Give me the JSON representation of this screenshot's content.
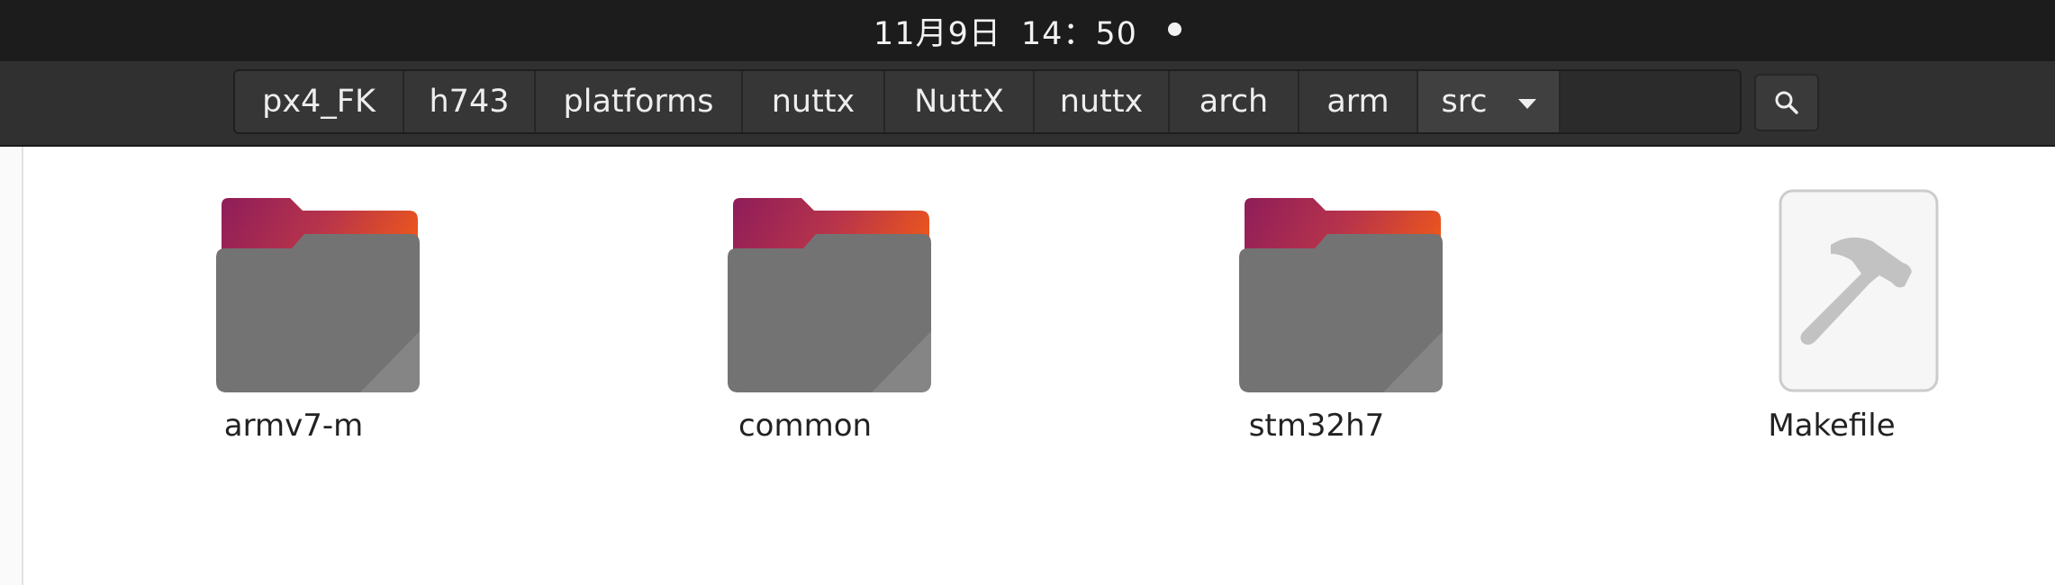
{
  "topbar": {
    "date": "11月9日",
    "time": "14：50"
  },
  "pathbar": {
    "crumbs": [
      "px4_FK",
      "h743",
      "platforms",
      "nuttx",
      "NuttX",
      "nuttx",
      "arch",
      "arm",
      "src"
    ]
  },
  "search_icon": "search-icon",
  "files": [
    {
      "name": "armv7-m",
      "icon": "folder-icon"
    },
    {
      "name": "common",
      "icon": "folder-icon"
    },
    {
      "name": "stm32h7",
      "icon": "folder-icon"
    },
    {
      "name": "Makefile",
      "icon": "makefile-icon"
    }
  ],
  "colors": {
    "folder_back_start": "#8f1d5a",
    "folder_back_end": "#e9541f",
    "folder_front": "#737373",
    "topbar": "#1c1c1c",
    "headerbar": "#303030"
  }
}
